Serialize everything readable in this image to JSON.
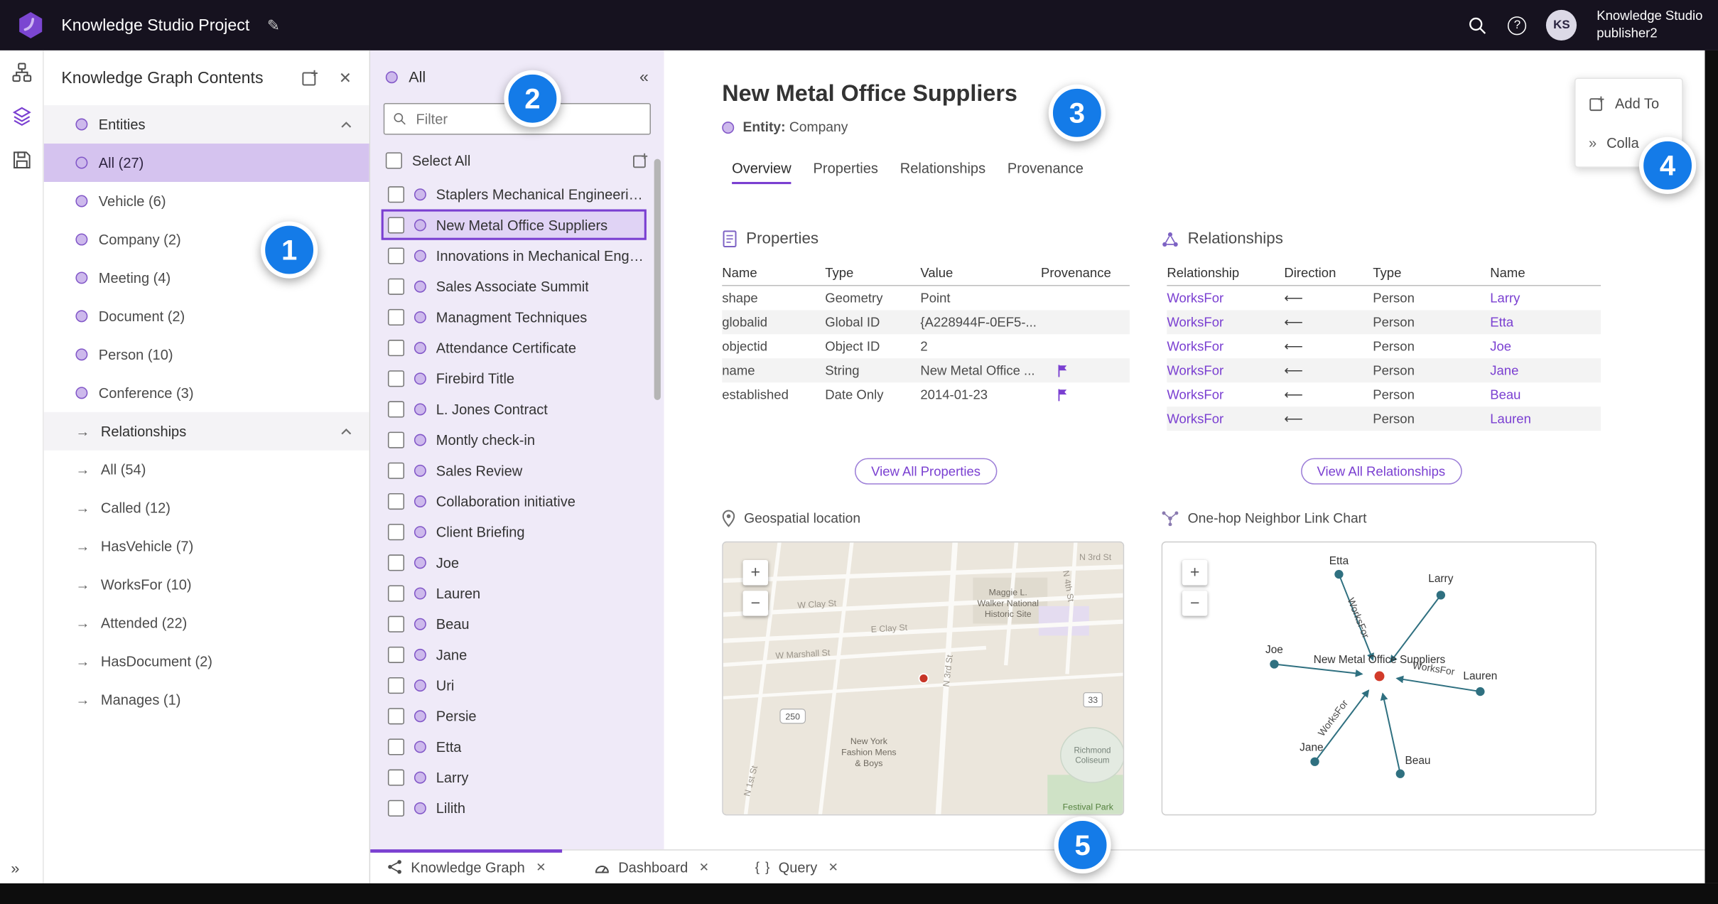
{
  "topbar": {
    "title": "Knowledge Studio Project",
    "user": {
      "initials": "KS",
      "name": "Knowledge Studio",
      "role": "publisher2"
    }
  },
  "contents_panel": {
    "title": "Knowledge Graph Contents",
    "sections": {
      "entities": {
        "label": "Entities"
      },
      "relationships": {
        "label": "Relationships"
      }
    },
    "entity_items": [
      {
        "label": "All (27)"
      },
      {
        "label": "Vehicle (6)"
      },
      {
        "label": "Company (2)"
      },
      {
        "label": "Meeting (4)"
      },
      {
        "label": "Document (2)"
      },
      {
        "label": "Person (10)"
      },
      {
        "label": "Conference (3)"
      }
    ],
    "relationship_items": [
      {
        "label": "All (54)"
      },
      {
        "label": "Called (12)"
      },
      {
        "label": "HasVehicle (7)"
      },
      {
        "label": "WorksFor (10)"
      },
      {
        "label": "Attended (22)"
      },
      {
        "label": "HasDocument (2)"
      },
      {
        "label": "Manages (1)"
      }
    ]
  },
  "list_panel": {
    "header": "All",
    "filter_placeholder": "Filter",
    "select_all_label": "Select All",
    "items": [
      {
        "label": "Staplers Mechanical Engineering"
      },
      {
        "label": "New Metal Office Suppliers"
      },
      {
        "label": "Innovations in Mechanical Engin..."
      },
      {
        "label": "Sales Associate Summit"
      },
      {
        "label": "Managment Techniques"
      },
      {
        "label": "Attendance Certificate"
      },
      {
        "label": "Firebird Title"
      },
      {
        "label": "L. Jones Contract"
      },
      {
        "label": "Montly check-in"
      },
      {
        "label": "Sales Review"
      },
      {
        "label": "Collaboration initiative"
      },
      {
        "label": "Client Briefing"
      },
      {
        "label": "Joe"
      },
      {
        "label": "Lauren"
      },
      {
        "label": "Beau"
      },
      {
        "label": "Jane"
      },
      {
        "label": "Uri"
      },
      {
        "label": "Persie"
      },
      {
        "label": "Etta"
      },
      {
        "label": "Larry"
      },
      {
        "label": "Lilith"
      }
    ]
  },
  "detail": {
    "title": "New Metal Office Suppliers",
    "entity_prefix": "Entity:",
    "entity_type": "Company",
    "tabs": [
      {
        "label": "Overview"
      },
      {
        "label": "Properties"
      },
      {
        "label": "Relationships"
      },
      {
        "label": "Provenance"
      }
    ],
    "actions": {
      "add_to": "Add To",
      "collapse": "Colla"
    },
    "properties": {
      "heading": "Properties",
      "columns": [
        "Name",
        "Type",
        "Value",
        "Provenance"
      ],
      "rows": [
        {
          "name": "shape",
          "type": "Geometry",
          "value": "Point"
        },
        {
          "name": "globalid",
          "type": "Global ID",
          "value": "{A228944F-0EF5-..."
        },
        {
          "name": "objectid",
          "type": "Object ID",
          "value": "2"
        },
        {
          "name": "name",
          "type": "String",
          "value": "New Metal Office ..."
        },
        {
          "name": "established",
          "type": "Date Only",
          "value": "2014-01-23"
        }
      ],
      "view_all_label": "View All Properties"
    },
    "relationships": {
      "heading": "Relationships",
      "columns": [
        "Relationship",
        "Direction",
        "Type",
        "Name"
      ],
      "rows": [
        {
          "relationship": "WorksFor",
          "direction": "⟵",
          "type": "Person",
          "name": "Larry"
        },
        {
          "relationship": "WorksFor",
          "direction": "⟵",
          "type": "Person",
          "name": "Etta"
        },
        {
          "relationship": "WorksFor",
          "direction": "⟵",
          "type": "Person",
          "name": "Joe"
        },
        {
          "relationship": "WorksFor",
          "direction": "⟵",
          "type": "Person",
          "name": "Jane"
        },
        {
          "relationship": "WorksFor",
          "direction": "⟵",
          "type": "Person",
          "name": "Beau"
        },
        {
          "relationship": "WorksFor",
          "direction": "⟵",
          "type": "Person",
          "name": "Lauren"
        }
      ],
      "view_all_label": "View All Relationships"
    },
    "map": {
      "heading": "Geospatial location",
      "zoom_in": "+",
      "zoom_out": "−",
      "streets": {
        "w_clay": "W Clay St",
        "e_clay": "E Clay St",
        "w_marshall": "W Marshall St",
        "n_3rd_v": "N 3rd St",
        "n_3rd_h": "N 3rd St",
        "n_4th": "N 4th St",
        "n_1st": "N 1st St"
      },
      "pois": {
        "maggie_1": "Maggie L.",
        "maggie_2": "Walker National",
        "maggie_3": "Historic Site",
        "fashion_1": "New York",
        "fashion_2": "Fashion Mens",
        "fashion_3": "& Boys",
        "coliseum_1": "Richmond",
        "coliseum_2": "Coliseum",
        "park": "Festival Park"
      },
      "shields": {
        "s250": "250",
        "s33": "33"
      }
    },
    "link_chart": {
      "heading": "One-hop Neighbor Link Chart",
      "zoom_in": "+",
      "zoom_out": "−",
      "center_label": "New Metal Office Suppliers",
      "edge_label": "WorksFor",
      "nodes": [
        {
          "label": "Etta"
        },
        {
          "label": "Larry"
        },
        {
          "label": "Joe"
        },
        {
          "label": "Jane"
        },
        {
          "label": "Beau"
        },
        {
          "label": "Lauren"
        }
      ]
    }
  },
  "bottom_tabs": [
    {
      "label": "Knowledge Graph"
    },
    {
      "label": "Dashboard"
    },
    {
      "label": "Query"
    }
  ],
  "badges": [
    "1",
    "2",
    "3",
    "4",
    "5"
  ],
  "colors": {
    "accent": "#7a3fd1",
    "badge_blue": "#147be8",
    "selection": "#d5c3ef",
    "topbar": "#16121f"
  }
}
